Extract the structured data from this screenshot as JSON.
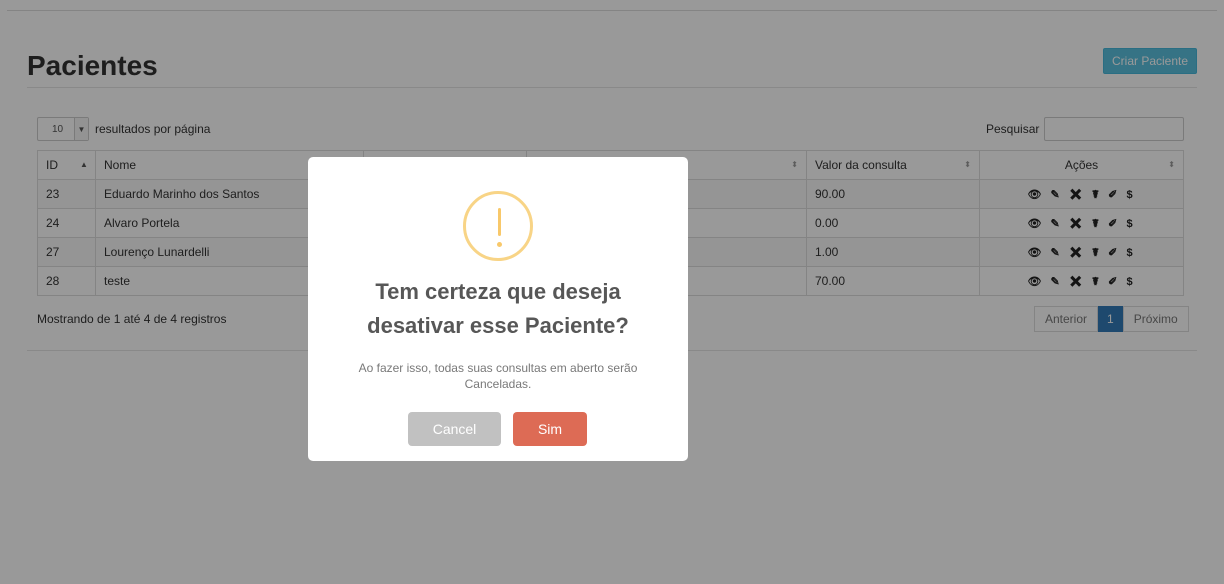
{
  "header": {
    "title": "Pacientes",
    "create_label": "Criar Paciente"
  },
  "table_controls": {
    "page_length": "10",
    "length_label": "resultados por página",
    "search_label": "Pesquisar"
  },
  "table": {
    "columns": {
      "id": "ID",
      "name": "Nome",
      "col3": "",
      "col4": "",
      "value": "Valor da consulta",
      "actions": "Ações"
    },
    "rows": [
      {
        "id": "23",
        "name": "Eduardo Marinho dos Santos",
        "value": "90.00"
      },
      {
        "id": "24",
        "name": "Alvaro Portela",
        "value": "0.00"
      },
      {
        "id": "27",
        "name": "Lourenço Lunardelli",
        "value": "1.00"
      },
      {
        "id": "28",
        "name": "teste",
        "value": "70.00"
      }
    ],
    "action_icons": "👁 ✎ ✖ ☤ ✐ $"
  },
  "footer": {
    "info": "Mostrando de 1 até 4 de 4 registros",
    "prev": "Anterior",
    "page": "1",
    "next": "Próximo"
  },
  "modal": {
    "title": "Tem certeza que deseja desativar esse Paciente?",
    "text": "Ao fazer isso, todas suas consultas em aberto serão Canceladas.",
    "cancel_label": "Cancel",
    "confirm_label": "Sim"
  },
  "colors": {
    "accent": "#5bc0de",
    "confirm": "#dd6b55",
    "cancel": "#c1c1c1",
    "warning": "#f8d486",
    "pager_active": "#337ab7"
  }
}
